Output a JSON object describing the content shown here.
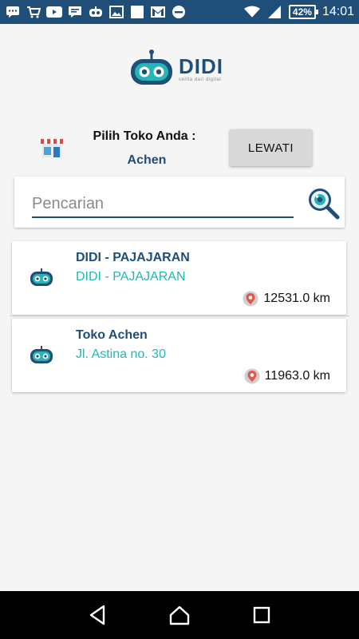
{
  "status_bar": {
    "battery": "42%",
    "time": "14:01",
    "left_icons": [
      "chat-icon",
      "cart-icon",
      "youtube-icon",
      "message-icon",
      "robot-icon",
      "image-icon",
      "square-icon",
      "gmail-icon",
      "minus-circle-icon"
    ],
    "right_icons": [
      "wifi-icon",
      "signal-icon",
      "battery-icon"
    ]
  },
  "logo": {
    "word": "DIDI",
    "tagline": "cerita dari digital"
  },
  "store_selector": {
    "label": "Pilih Toko Anda :",
    "selected_store": "Achen",
    "skip_label": "LEWATI"
  },
  "search": {
    "placeholder": "Pencarian",
    "value": ""
  },
  "stores": [
    {
      "name": "DIDI - PAJAJARAN",
      "address": "DIDI - PAJAJARAN",
      "distance": "12531.0 km"
    },
    {
      "name": "Toko Achen",
      "address": "Jl. Astina no. 30",
      "distance": "11963.0 km"
    }
  ],
  "colors": {
    "primary": "#1f4e79",
    "accent": "#26b5b5",
    "button": "#d8d8d8"
  },
  "nav": [
    "back-icon",
    "home-icon",
    "recents-icon"
  ]
}
